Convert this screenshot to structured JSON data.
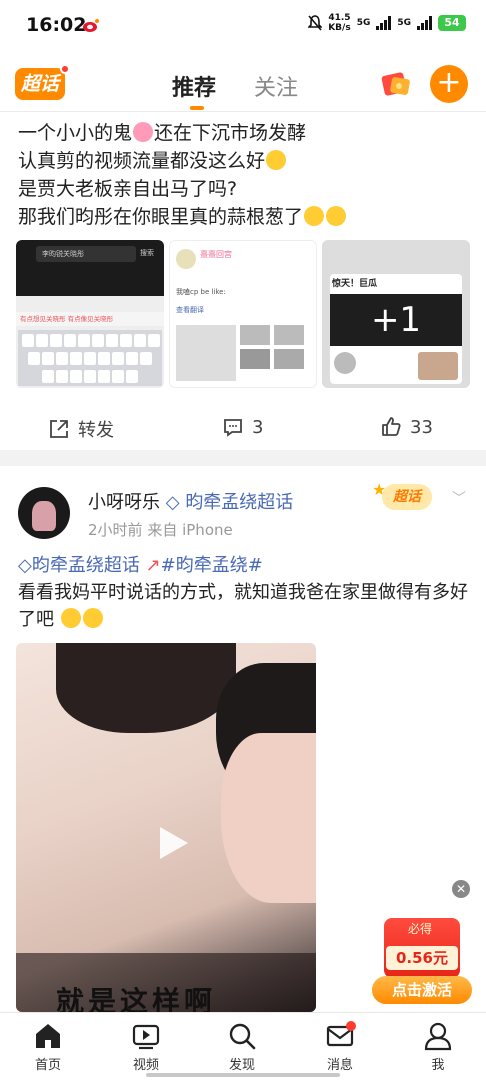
{
  "status_bar": {
    "time": "16:02",
    "speed_value": "41.5",
    "speed_unit": "KB/s",
    "sim1": "5G",
    "sim2": "5G",
    "battery": "54"
  },
  "top_nav": {
    "logo": "超话",
    "tab_recommend": "推荐",
    "tab_follow": "关注",
    "plus": "+"
  },
  "post1": {
    "lines": [
      "一个小小的鬼",
      "还在下沉市场发酵",
      "认真剪的视频流量都没这么好",
      "是贾大老板亲自出马了吗?",
      "那我们昀彤在你眼里真的蒜根葱了"
    ],
    "thumb1": {
      "search": "李昀锐关晓彤",
      "search_btn": "搜索",
      "suggest": "有点想见关晓彤   有点像见关晓彤"
    },
    "thumb2": {
      "name": "熹熹回宫",
      "sub": "我嗑cp  be like:",
      "translate": "查看翻译"
    },
    "thumb3": {
      "header": "惊天！巨瓜",
      "big": "+1"
    },
    "actions": {
      "repost": "转发",
      "comments": "3",
      "likes": "33"
    }
  },
  "post2": {
    "username": "小呀呀乐",
    "topic": "昀牵孟绕超话",
    "time": "2小时前",
    "source": "来自 iPhone",
    "badge": "超话",
    "tag1": "昀牵孟绕超话",
    "tag2": "#昀牵孟绕#",
    "text": "看看我妈平时说话的方式，就知道我爸在家里做得有多好了吧",
    "video_caption": "就是这样啊"
  },
  "promo": {
    "must": "必得",
    "amount": "0.56元",
    "cta": "点击激活"
  },
  "bottom_nav": {
    "home": "首页",
    "video": "视频",
    "discover": "发现",
    "messages": "消息",
    "me": "我"
  },
  "colors": {
    "accent": "#ff8a00",
    "topic_blue": "#4a6ab5"
  }
}
